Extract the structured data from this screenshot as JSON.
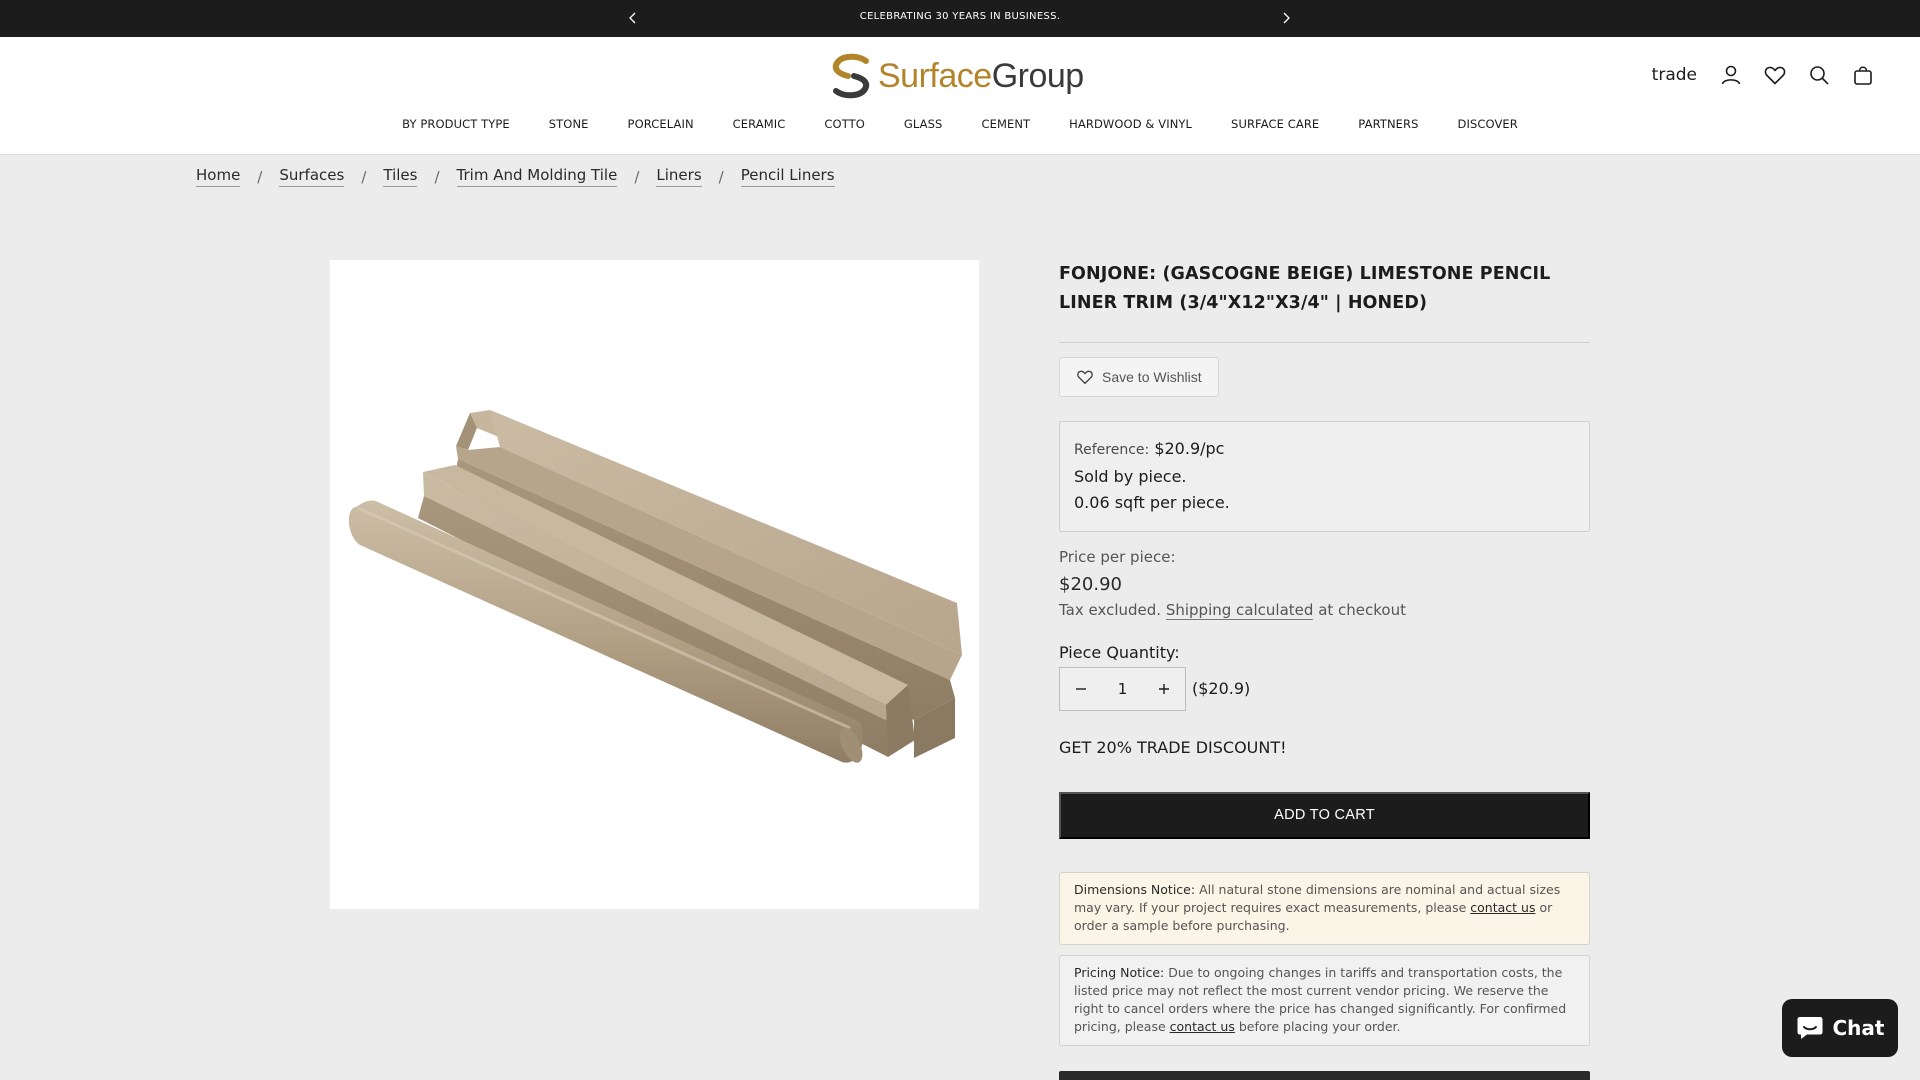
{
  "announcement": {
    "message": "CELEBRATING 30 YEARS IN BUSINESS.",
    "prev_icon": "chevron-left-icon",
    "next_icon": "chevron-right-icon"
  },
  "header": {
    "logo_part1": "Surface",
    "logo_part2": "Group",
    "trade_label": "trade",
    "icons": [
      "account-icon",
      "heart-icon",
      "search-icon",
      "bag-icon"
    ],
    "brand_colors": {
      "gold": "#b2852a",
      "dark": "#3a3a3a"
    }
  },
  "nav": {
    "items": [
      {
        "label": "BY PRODUCT TYPE"
      },
      {
        "label": "STONE"
      },
      {
        "label": "PORCELAIN"
      },
      {
        "label": "CERAMIC"
      },
      {
        "label": "COTTO"
      },
      {
        "label": "GLASS"
      },
      {
        "label": "CEMENT"
      },
      {
        "label": "HARDWOOD & VINYL"
      },
      {
        "label": "SURFACE CARE"
      },
      {
        "label": "PARTNERS"
      },
      {
        "label": "DISCOVER"
      }
    ]
  },
  "breadcrumb": {
    "items": [
      "Home",
      "Surfaces",
      "Tiles",
      "Trim And Molding Tile",
      "Liners",
      "Pencil Liners"
    ],
    "separator": "/"
  },
  "product": {
    "title": "FONJONE: (GASCOGNE BEIGE) LIMESTONE PENCIL LINER TRIM (3/4\"X12\"X3/4\" | HONED)",
    "wishlist_label": "Save to Wishlist",
    "reference_label": "Reference:",
    "reference_value": "$20.9/pc",
    "sold_by": "Sold by piece.",
    "sqft": "0.06 sqft per piece.",
    "price_label": "Price per piece:",
    "price": "$20.90",
    "tax_prefix": "Tax excluded.",
    "shipping_link": "Shipping calculated",
    "tax_suffix": "at checkout",
    "quantity_label": "Piece Quantity:",
    "quantity_value": "1",
    "quantity_total": "($20.9)",
    "trade_discount": "GET 20% TRADE DISCOUNT!",
    "add_to_cart": "ADD TO CART"
  },
  "notices": {
    "dimensions_title": "Dimensions Notice:",
    "dimensions_text": "All natural stone dimensions are nominal and actual sizes may vary. If your project requires exact measurements, please",
    "dimensions_link": "contact us",
    "dimensions_tail": "or order a sample before purchasing.",
    "pricing_title": "Pricing Notice:",
    "pricing_text": "Due to ongoing changes in tariffs and transportation costs, the listed price may not reflect the most current vendor pricing. We reserve the right to cancel orders where the price has changed significantly. For confirmed pricing, please",
    "pricing_link": "contact us",
    "pricing_tail": "before placing your order."
  },
  "chat": {
    "label": "Chat",
    "icon": "chat-bubble-icon"
  }
}
